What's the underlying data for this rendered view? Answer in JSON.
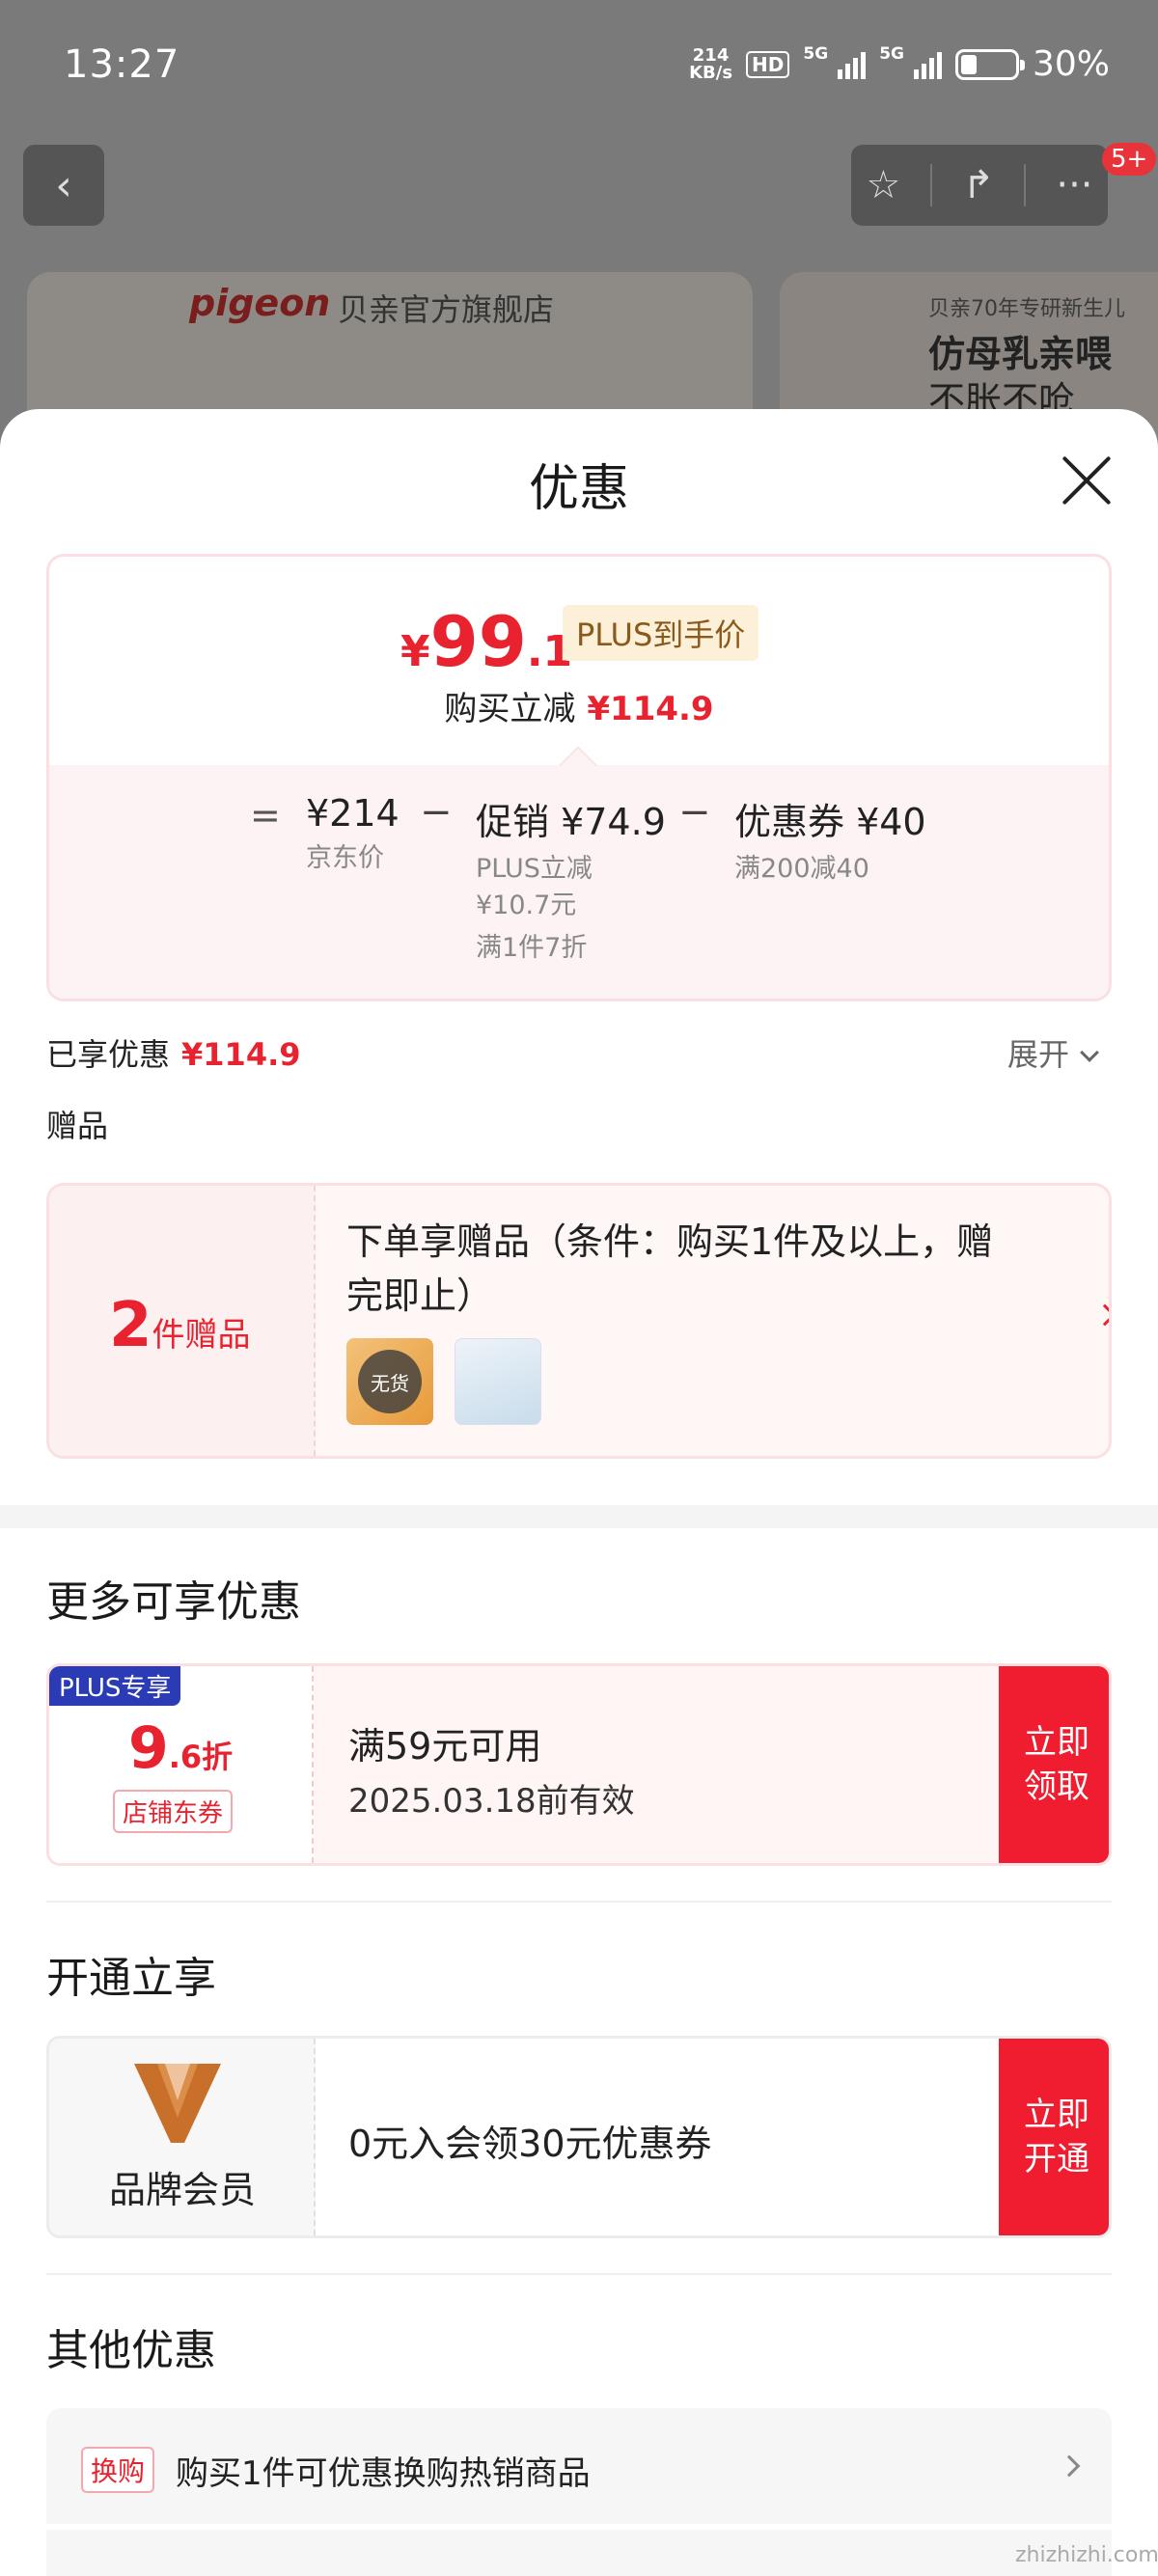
{
  "status_bar": {
    "time": "13:27",
    "net_speed_value": "214",
    "net_speed_unit": "KB/s",
    "hd_label": "HD",
    "signal_label": "5G",
    "battery_percent": "30%",
    "battery_level": 0.3
  },
  "nav": {
    "badge": "5+"
  },
  "banner": {
    "logo_text": "pigeon",
    "store_name": "贝亲官方旗舰店",
    "right_line1": "贝亲70年专研新生儿",
    "right_line2": "仿母乳亲喂",
    "right_line3": "不胀不呛"
  },
  "sheet": {
    "title": "优惠"
  },
  "summary": {
    "price_currency": "¥",
    "price_int": "99",
    "price_dec": ".1",
    "price_tag": "PLUS到手价",
    "reduce_label": "购买立减",
    "reduce_value": "¥114.9",
    "eq": "=",
    "minus": "−",
    "jd_price": "¥214",
    "jd_price_label": "京东价",
    "promo_main": "促销 ¥74.9",
    "promo_sub1": "PLUS立减",
    "promo_sub2": "¥10.7元",
    "promo_sub3": "满1件7折",
    "coupon_main": "优惠券 ¥40",
    "coupon_sub": "满200减40"
  },
  "enjoyed": {
    "label": "已享优惠",
    "value": "¥114.9",
    "expand_label": "展开"
  },
  "gift": {
    "section_label": "赠品",
    "count": "2",
    "count_unit": "件赠品",
    "text": "下单享赠品（条件：购买1件及以上，赠完即止）",
    "out_of_stock": "无货"
  },
  "more_offers": {
    "title": "更多可享优惠",
    "plus_ribbon": "PLUS专享",
    "discount_big": "9",
    "discount_small": ".6折",
    "shop_tag": "店铺东券",
    "condition": "满59元可用",
    "expiry": "2025.03.18前有效",
    "cta": "立即领取"
  },
  "membership": {
    "title": "开通立享",
    "label": "品牌会员",
    "text": "0元入会领30元优惠券",
    "cta": "立即开通",
    "brand_color": "#c8702a"
  },
  "other": {
    "title": "其他优惠",
    "tag": "换购",
    "text": "购买1件可优惠换购热销商品"
  },
  "watermark": "zhizhizhi.com",
  "colors": {
    "accent_red": "#e8232f",
    "cta_red": "#f01c2f",
    "plus_blue": "#2a3bb5"
  }
}
